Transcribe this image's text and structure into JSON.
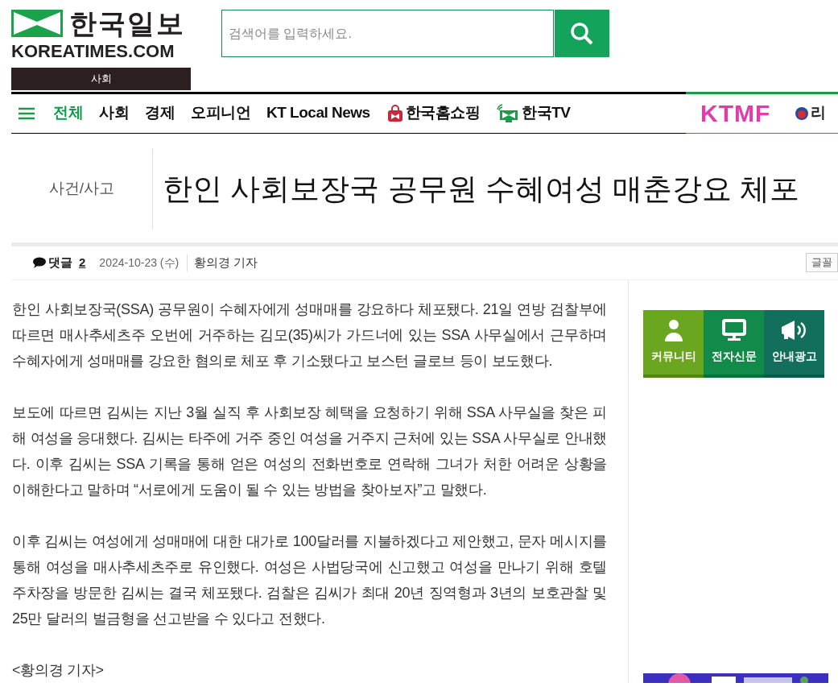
{
  "logo": {
    "korean": "한국일보",
    "english": "KOREATIMES.COM"
  },
  "section_label": "사회",
  "search": {
    "placeholder": "검색어를 입력하세요."
  },
  "nav": [
    {
      "label": "전체",
      "kind": "text",
      "selected": true
    },
    {
      "label": "사회",
      "kind": "text",
      "selected": false
    },
    {
      "label": "경제",
      "kind": "text",
      "selected": false
    },
    {
      "label": "오피니언",
      "kind": "text",
      "selected": false
    },
    {
      "label": "KT Local News",
      "kind": "text",
      "selected": false
    },
    {
      "label": "한국홈쇼핑",
      "kind": "shop",
      "selected": false
    },
    {
      "label": "한국TV",
      "kind": "tv",
      "selected": false
    }
  ],
  "nav_right": {
    "brand": "KTMF",
    "cut_item": "리"
  },
  "article": {
    "category": "사건/사고",
    "title": "한인 사회보장국 공무원 수혜여성 매춘강요 체포",
    "comments_label": "댓글",
    "comments_count": "2",
    "date": "2024-10-23 (수)",
    "author": "황의경 기자",
    "font_button": "글꼴",
    "paragraphs": [
      "한인 사회보장국(SSA) 공무원이 수혜자에게 성매매를 강요하다 체포됐다. 21일 연방 검찰부에 따르면 매사추세츠주 오번에 거주하는 김모(35)씨가 가드너에 있는 SSA 사무실에서 근무하며 수혜자에게 성매매를 강요한 혐의로 체포 후 기소됐다고 보스턴 글로브 등이 보도했다.",
      "보도에 따르면 김씨는 지난 3월 실직 후 사회보장 혜택을 요청하기 위해 SSA 사무실을 찾은 피해 여성을 응대했다. 김씨는 타주에 거주 중인 여성을 거주지 근처에 있는 SSA 사무실로 안내했다. 이후 김씨는 SSA 기록을 통해 얻은 여성의 전화번호로 연락해 그녀가 처한 어려운 상황을 이해한다고 말하며 “서로에게 도움이 될 수 있는 방법을 찾아보자”고 말했다.",
      "이후 김씨는 여성에게 성매매에 대한 대가로 100달러를 지불하겠다고 제안했고, 문자 메시지를 통해 여성을 매사추세츠주로 유인했다. 여성은 사법당국에 신고했고 여성을 만나기 위해 호텔 주차장을 방문한 김씨는 결국 체포됐다. 검찰은 김씨가 최대 20년 징역형과 3년의 보호관찰 및 25만 달러의 벌금형을 선고받을 수 있다고 전했다.",
      "<황의경 기자>"
    ]
  },
  "sidebar": {
    "buttons": [
      {
        "label": "커뮤니티",
        "kind": "person",
        "color": "#6aa61f"
      },
      {
        "label": "전자신문",
        "kind": "monitor",
        "color": "#128a4a"
      },
      {
        "label": "안내광고",
        "kind": "megaphone",
        "color": "#116f5c"
      }
    ]
  }
}
